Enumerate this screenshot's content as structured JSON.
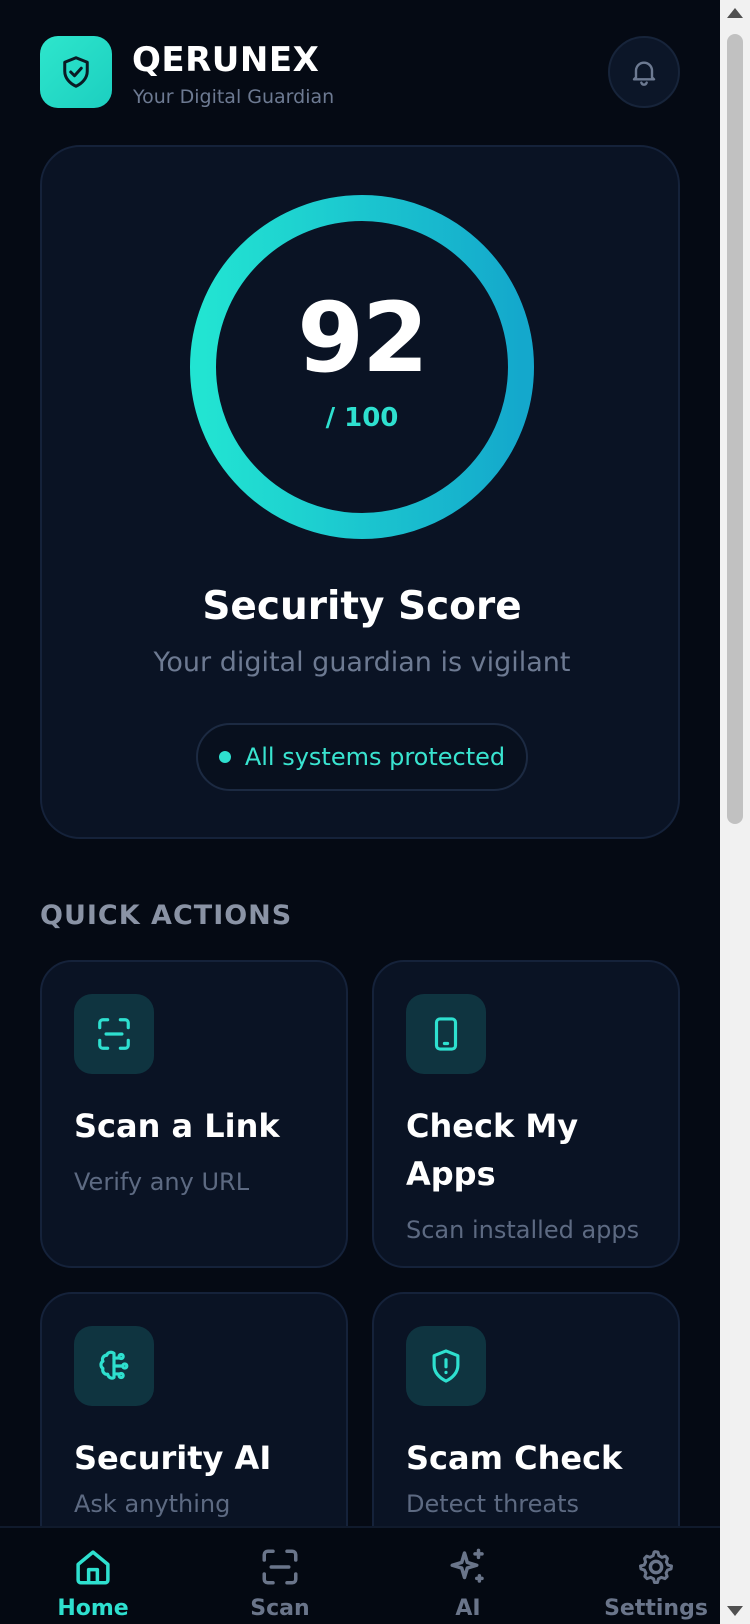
{
  "header": {
    "brand_name": "QERUNEX",
    "brand_tagline": "Your Digital Guardian",
    "logo_icon": "shield-check-icon",
    "notification_icon": "bell-icon"
  },
  "score_card": {
    "score": "92",
    "max": "/ 100",
    "score_value": 92,
    "score_max_value": 100,
    "title": "Security Score",
    "subtitle": "Your digital guardian is vigilant",
    "status": "All systems protected"
  },
  "quick_actions": {
    "title": "QUICK ACTIONS",
    "items": [
      {
        "title": "Scan a Link",
        "subtitle": "Verify any URL",
        "icon": "scan-icon"
      },
      {
        "title": "Check My Apps",
        "subtitle": "Scan installed apps",
        "icon": "smartphone-icon"
      },
      {
        "title": "Security AI",
        "subtitle": "Ask anything",
        "icon": "brain-icon"
      },
      {
        "title": "Scam Check",
        "subtitle": "Detect threats",
        "icon": "shield-alert-icon"
      }
    ]
  },
  "nav": {
    "items": [
      {
        "label": "Home",
        "icon": "home-icon",
        "active": true
      },
      {
        "label": "Scan",
        "icon": "scan-icon",
        "active": false
      },
      {
        "label": "AI",
        "icon": "sparkles-icon",
        "active": false
      },
      {
        "label": "Settings",
        "icon": "gear-icon",
        "active": false
      }
    ]
  },
  "colors": {
    "background": "#050a14",
    "card": "#0a1324",
    "accent": "#2ee0cf",
    "muted_text": "#6d7a92"
  }
}
